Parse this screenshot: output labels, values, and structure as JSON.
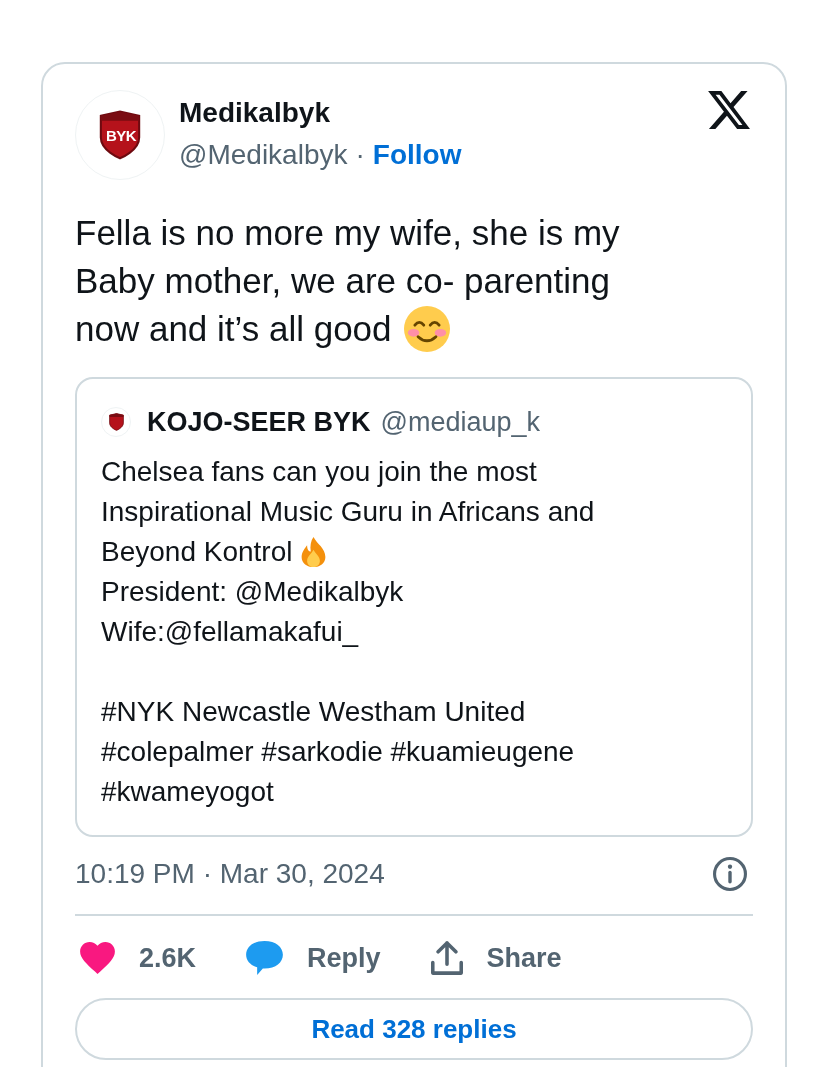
{
  "tweet": {
    "author": {
      "name": "Medikalbyk",
      "handle": "@Medikalbyk",
      "separator": "·",
      "follow_label": "Follow",
      "avatar": {
        "logo_text": "BYK"
      }
    },
    "text_lines": [
      {
        "kind": "plain",
        "text": "Fella is no more my wife, she is my Baby mother, we are co- parenting"
      },
      {
        "kind": "smiling_face",
        "text": "now and it’s all good"
      }
    ],
    "quoted": {
      "author": {
        "name": "KOJO-SEER BYK",
        "handle": "@mediaup_k"
      },
      "paragraphs": [
        {
          "lines": [
            {
              "kind": "plain",
              "text": "Chelsea fans can you join the most Inspirational Music Guru in Africans and"
            },
            {
              "kind": "fire",
              "text": "Beyond Kontrol"
            },
            {
              "kind": "plain",
              "text": "President: @Medikalbyk"
            },
            {
              "kind": "plain",
              "text": "Wife:@fellamakafui_"
            }
          ]
        },
        {
          "lines": [
            {
              "kind": "plain",
              "text": "#NYK Newcastle Westham United #colepalmer #sarkodie #kuamieugene #kwameyogot"
            }
          ]
        }
      ]
    },
    "timestamp": "10:19 PM · Mar 30, 2024",
    "actions": [
      {
        "kind": "like",
        "label": "2.6K"
      },
      {
        "kind": "reply",
        "label": "Reply"
      },
      {
        "kind": "share",
        "label": "Share"
      }
    ],
    "read_replies": "Read 328 replies"
  }
}
